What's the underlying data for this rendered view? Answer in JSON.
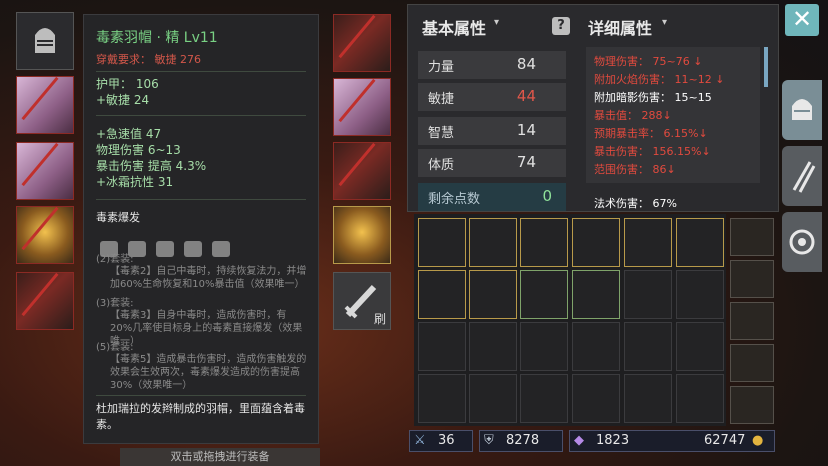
{
  "tooltip": {
    "title": "毒素羽帽 · 精 Lv11",
    "requirement": "穿戴要求：  敏捷 276",
    "base_stats": [
      "护甲：  106",
      "+敏捷 24"
    ],
    "bonus_stats": [
      "+急速值 47",
      "物理伤害 6~13",
      "暴击伤害 提高 4.3%",
      "+冰霜抗性 31"
    ],
    "set_name": "毒素爆发",
    "set_bonuses": [
      {
        "pieces": "(2)套装:",
        "text": "【毒素2】自己中毒时，持续恢复法力，并增加60%生命恢复和10%暴击值（效果唯一）"
      },
      {
        "pieces": "(3)套装:",
        "text": "【毒素3】自身中毒时，造成伤害时，有20%几率使目标身上的毒素直接爆发（效果唯一）"
      },
      {
        "pieces": "(5)套装:",
        "text": "【毒素5】造成暴击伤害时，造成伤害触发的效果会生效两次，毒素爆发造成的伤害提高30%（效果唯一）"
      }
    ],
    "description": "杜加瑞拉的发辫制成的羽帽，里面蕴含着毒素。"
  },
  "bottom_hint": "双击或拖拽进行装备",
  "attributes": {
    "basic_header": "基本属性",
    "detail_header": "详细属性",
    "stats": [
      {
        "label": "力量",
        "value": "84",
        "color": "#e0e0e0"
      },
      {
        "label": "敏捷",
        "value": "44",
        "color": "#e0574a"
      },
      {
        "label": "智慧",
        "value": "14",
        "color": "#e0e0e0"
      },
      {
        "label": "体质",
        "value": "74",
        "color": "#e0e0e0"
      }
    ],
    "remaining_label": "剩余点数",
    "remaining_value": "0",
    "details": [
      {
        "text": "物理伤害：  75~76  ↓",
        "color": "#e14a3e"
      },
      {
        "text": "附加火焰伤害：  11~12  ↓",
        "color": "#e14a3e"
      },
      {
        "text": "附加暗影伤害：  15~15",
        "color": "#ffffff"
      },
      {
        "text": "暴击值：  288↓",
        "color": "#e14a3e"
      },
      {
        "text": "预期暴击率：  6.15%↓",
        "color": "#e14a3e"
      },
      {
        "text": "暴击伤害：  156.15%↓",
        "color": "#e14a3e"
      },
      {
        "text": "范围伤害：  86↓",
        "color": "#e14a3e"
      }
    ],
    "spell_damage": "法术伤害：  67%"
  },
  "equip": {
    "skill_badge": "刷"
  },
  "resources": {
    "attack": "36",
    "defense": "8278",
    "gems": "1823",
    "gold": "62747"
  }
}
